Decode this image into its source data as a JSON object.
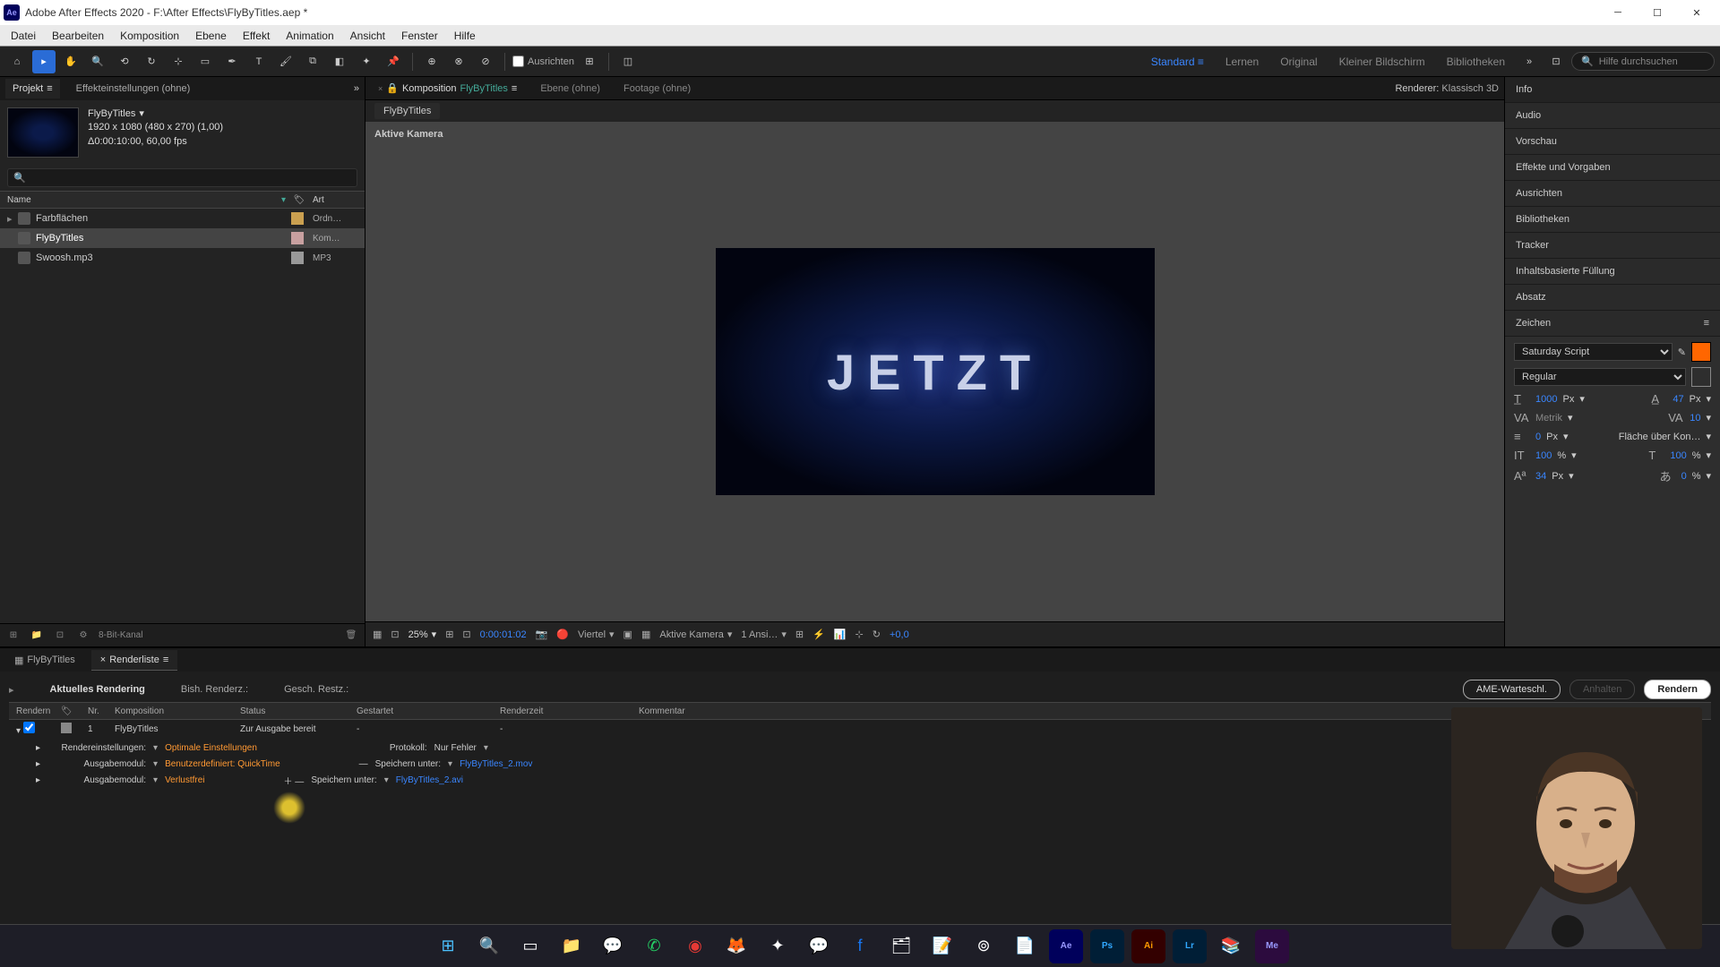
{
  "titlebar": {
    "app": "Ae",
    "title": "Adobe After Effects 2020 - F:\\After Effects\\FlyByTitles.aep *"
  },
  "menubar": [
    "Datei",
    "Bearbeiten",
    "Komposition",
    "Ebene",
    "Effekt",
    "Animation",
    "Ansicht",
    "Fenster",
    "Hilfe"
  ],
  "toolbar": {
    "snap_label": "Ausrichten",
    "workspace_active": "Standard",
    "workspaces": [
      "Lernen",
      "Original",
      "Kleiner Bildschirm",
      "Bibliotheken"
    ],
    "search_placeholder": "Hilfe durchsuchen"
  },
  "project_panel": {
    "tab_project": "Projekt",
    "tab_effects": "Effekteinstellungen (ohne)",
    "comp_name": "FlyByTitles",
    "comp_dims": "1920 x 1080 (480 x 270) (1,00)",
    "comp_duration": "Δ0:00:10:00, 60,00 fps",
    "cols": {
      "name": "Name",
      "tag": "",
      "art": "Art"
    },
    "items": [
      {
        "name": "Farbflächen",
        "art": "Ordn…",
        "selected": false,
        "expandable": true
      },
      {
        "name": "FlyByTitles",
        "art": "Kom…",
        "selected": true,
        "expandable": false
      },
      {
        "name": "Swoosh.mp3",
        "art": "MP3",
        "selected": false,
        "expandable": false
      }
    ],
    "footer_depth": "8-Bit-Kanal"
  },
  "comp_panel": {
    "tabs": {
      "comp": "Komposition",
      "comp_name": "FlyByTitles",
      "layer": "Ebene (ohne)",
      "footage": "Footage (ohne)"
    },
    "renderer_label": "Renderer:",
    "renderer_value": "Klassisch 3D",
    "breadcrumb": "FlyByTitles",
    "active_camera": "Aktive Kamera",
    "preview_text": "JETZT",
    "footer": {
      "zoom": "25%",
      "timecode": "0:00:01:02",
      "res": "Viertel",
      "view": "Aktive Kamera",
      "views": "1 Ansi…",
      "exposure": "+0,0"
    }
  },
  "right_panels": {
    "items": [
      "Info",
      "Audio",
      "Vorschau",
      "Effekte und Vorgaben",
      "Ausrichten",
      "Bibliotheken",
      "Tracker",
      "Inhaltsbasierte Füllung",
      "Absatz"
    ],
    "character": {
      "title": "Zeichen",
      "font": "Saturday Script",
      "style": "Regular",
      "size": "1000",
      "size_unit": "Px",
      "leading": "47",
      "leading_unit": "Px",
      "kerning": "Metrik",
      "tracking": "10",
      "stroke": "0",
      "stroke_unit": "Px",
      "fill_over": "Fläche über Kon…",
      "vscale": "100",
      "hscale": "100",
      "baseline": "34",
      "baseline_unit": "Px",
      "tsume": "0",
      "pct": "%"
    }
  },
  "render_queue": {
    "tab_timeline": "FlyByTitles",
    "tab_queue": "Renderliste",
    "current_label": "Aktuelles Rendering",
    "elapsed_label": "Bish. Renderz.:",
    "remain_label": "Gesch. Restz.:",
    "btn_ame": "AME-Warteschl.",
    "btn_stop": "Anhalten",
    "btn_render": "Rendern",
    "cols": {
      "render": "Rendern",
      "nr": "Nr.",
      "comp": "Komposition",
      "status": "Status",
      "started": "Gestartet",
      "rtime": "Renderzeit",
      "comment": "Kommentar"
    },
    "row": {
      "nr": "1",
      "comp": "FlyByTitles",
      "status": "Zur Ausgabe bereit",
      "started": "-",
      "rtime": "-"
    },
    "settings": {
      "render_settings_label": "Rendereinstellungen:",
      "render_settings_value": "Optimale Einstellungen",
      "protocol_label": "Protokoll:",
      "protocol_value": "Nur Fehler",
      "output1_label": "Ausgabemodul:",
      "output1_value": "Benutzerdefiniert: QuickTime",
      "output1_save_label": "Speichern unter:",
      "output1_file": "FlyByTitles_2.mov",
      "output2_label": "Ausgabemodul:",
      "output2_value": "Verlustfrei",
      "output2_save_label": "Speichern unter:",
      "output2_file": "FlyByTitles_2.avi"
    }
  }
}
